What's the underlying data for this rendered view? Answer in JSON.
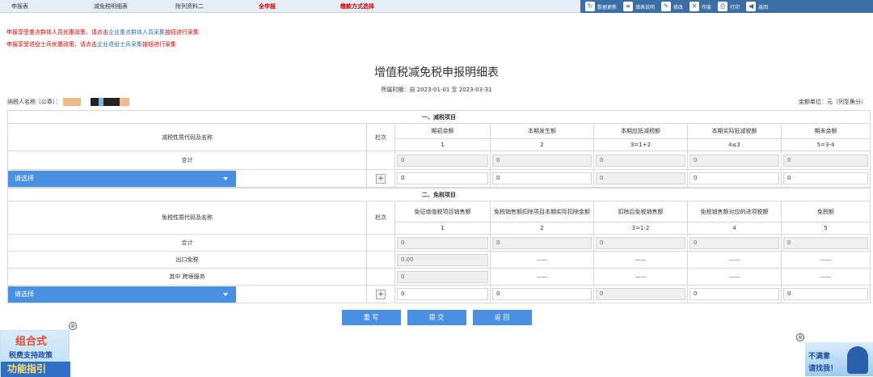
{
  "top_tabs": [
    "申报表",
    "减免税明细表",
    "附列资料二",
    "全申报",
    "缴款方式选择"
  ],
  "toolbar": [
    "数据更新",
    "填表说明",
    "修改",
    "作废",
    "打印",
    "返回"
  ],
  "notices": [
    {
      "pre": "申报享受重点群体人员优惠政策，请点击",
      "link": "企业重点群体人员采集",
      "post": "按钮进行采集"
    },
    {
      "pre": "申报享受退役士兵优惠政策，请点击",
      "link": "企业退役士兵采集",
      "post": "按钮进行采集"
    }
  ],
  "title": "增值税减免税申报明细表",
  "period": "所属时期：自 2023-01-01 至 2023-03-31",
  "taxpayer_label": "纳税人名称（公章）：",
  "unit": "金额单位：元（列至角分）",
  "reduction": {
    "section": "一、减税项目",
    "name_header": "减税性质代码及名称",
    "col_header": "栏次",
    "columns": [
      "期初余额",
      "本期发生额",
      "本期应抵减税额",
      "本期实际抵减税额",
      "期末余额"
    ],
    "col_nums": [
      "1",
      "2",
      "3=1+2",
      "4≤3",
      "5=3-4"
    ],
    "total_label": "合计",
    "total_values": [
      "0",
      "0",
      "0",
      "0",
      "0"
    ],
    "select": "请选择",
    "input_values": [
      "0",
      "0",
      "0",
      "0",
      "0"
    ]
  },
  "exemption": {
    "section": "二、免税项目",
    "name_header": "免税性质代码及名称",
    "col_header": "栏次",
    "columns": [
      "免征增值税项目销售额",
      "免税销售额扣除项目本期实际扣除金额",
      "扣除后免税销售额",
      "免税销售额对应的进项税额",
      "免税额"
    ],
    "col_nums": [
      "1",
      "2",
      "3=1-2",
      "4",
      "5"
    ],
    "total_label": "合计",
    "total_values": [
      "0",
      "0",
      "0",
      "0",
      "0"
    ],
    "export_label": "出口免税",
    "export_value": "0.00",
    "cross_label": "其中 跨境服务",
    "cross_value": "0",
    "dash": "——",
    "select": "请选择",
    "input_values": [
      "0",
      "0",
      "0",
      "0",
      "0"
    ]
  },
  "buttons": [
    "重 写",
    "提 交",
    "返 回"
  ],
  "promo_left": [
    "组合式",
    "税费支持政策",
    "功能指引"
  ],
  "promo_right": [
    "不满意",
    "请找我！"
  ],
  "close_glyph": "⊗"
}
